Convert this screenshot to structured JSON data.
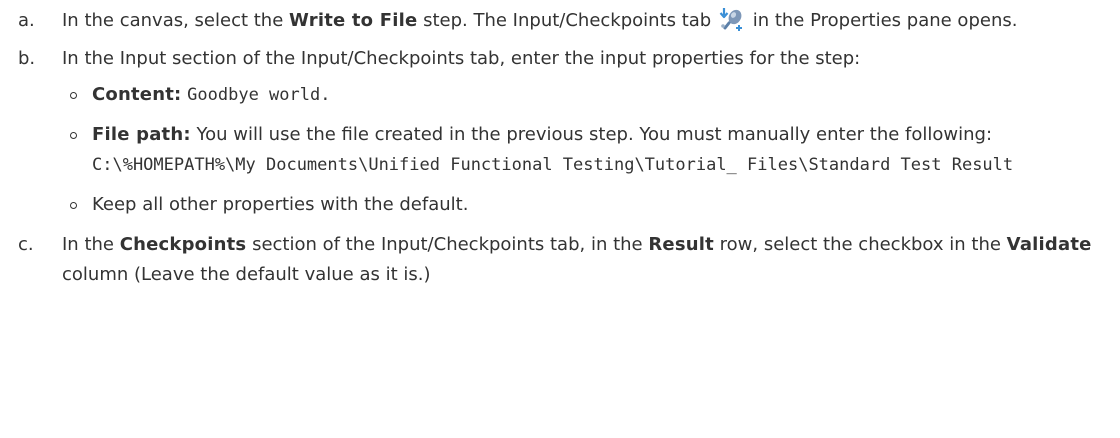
{
  "steps": {
    "a": {
      "letter": "a.",
      "text1": "In the canvas, select the ",
      "bold1": "Write to File",
      "text2": " step. The Input/Checkpoints tab ",
      "icon": "input-checkpoints-tab-icon",
      "text3": " in the Properties pane opens."
    },
    "b": {
      "letter": "b.",
      "text": "In the Input section of the Input/Checkpoints tab, enter the input properties for the step:",
      "bullets": {
        "content_label": "Content:",
        "content_value": "Goodbye world.",
        "filepath_label": "File path:",
        "filepath_text": " You will use the file created in the previous step. You must manually enter the following: ",
        "filepath_value": "C:\\%HOMEPATH%\\My Documents\\Unified Functional Testing\\Tutorial_ Files\\Standard Test Result",
        "keep_text": "Keep all other properties with the default."
      }
    },
    "c": {
      "letter": "c.",
      "text1": "In the ",
      "bold1": "Checkpoints",
      "text2": " section of the Input/Checkpoints tab, in the ",
      "bold2": "Result",
      "text3": " row, select the checkbox in the ",
      "bold3": "Validate",
      "text4": " column (Leave the default value as it is.)"
    }
  },
  "colors": {
    "text": "#333333",
    "icon_primary": "#5b7fa8",
    "icon_arrow": "#3a8fd6"
  }
}
